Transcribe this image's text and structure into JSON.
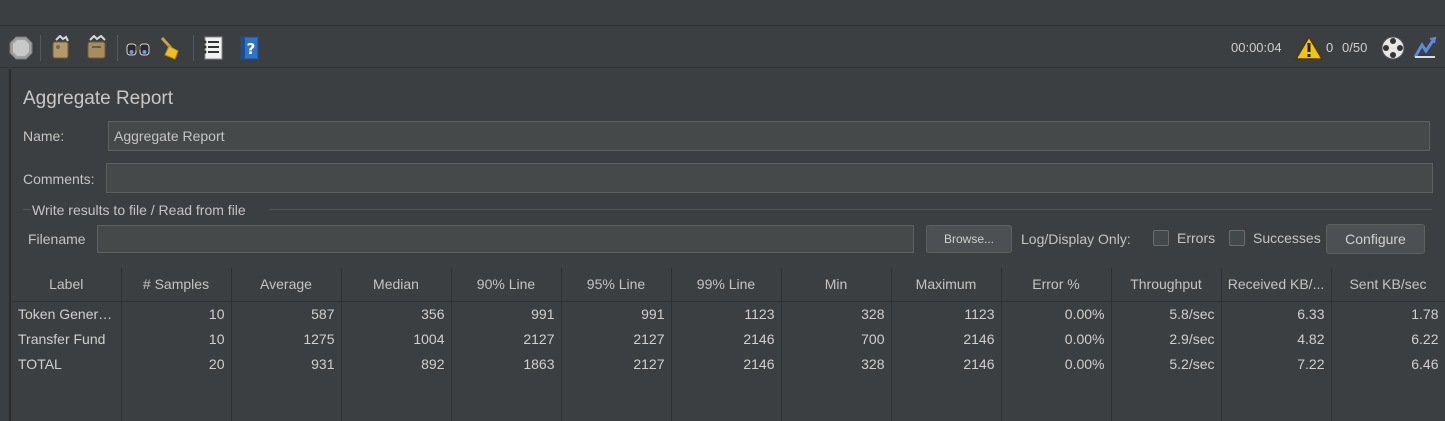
{
  "toolbar": {
    "icons": [
      "stop-icon",
      "clear-icon",
      "clear-all-icon",
      "search-icon",
      "reset-search-icon",
      "function-helper-icon",
      "help-icon"
    ],
    "elapsed_time": "00:00:04",
    "warning_count": "0",
    "threads": "0/50",
    "accent": "#e8c840"
  },
  "panel": {
    "title": "Aggregate Report",
    "name_label": "Name:",
    "name_value": "Aggregate Report",
    "comments_label": "Comments:",
    "comments_value": "",
    "group_title": "Write results to file / Read from file",
    "filename_label": "Filename",
    "filename_value": "",
    "browse_label": "Browse...",
    "log_display_label": "Log/Display Only:",
    "errors_label": "Errors",
    "successes_label": "Successes",
    "configure_label": "Configure"
  },
  "table": {
    "columns": [
      "Label",
      "# Samples",
      "Average",
      "Median",
      "90% Line",
      "95% Line",
      "99% Line",
      "Min",
      "Maximum",
      "Error %",
      "Throughput",
      "Received KB/...",
      "Sent KB/sec"
    ],
    "rows": [
      [
        "Token Genera...",
        "10",
        "587",
        "356",
        "991",
        "991",
        "1123",
        "328",
        "1123",
        "0.00%",
        "5.8/sec",
        "6.33",
        "1.78"
      ],
      [
        "Transfer Fund",
        "10",
        "1275",
        "1004",
        "2127",
        "2127",
        "2146",
        "700",
        "2146",
        "0.00%",
        "2.9/sec",
        "4.82",
        "6.22"
      ],
      [
        "TOTAL",
        "20",
        "931",
        "892",
        "1863",
        "2127",
        "2146",
        "328",
        "2146",
        "0.00%",
        "5.2/sec",
        "7.22",
        "6.46"
      ]
    ]
  }
}
